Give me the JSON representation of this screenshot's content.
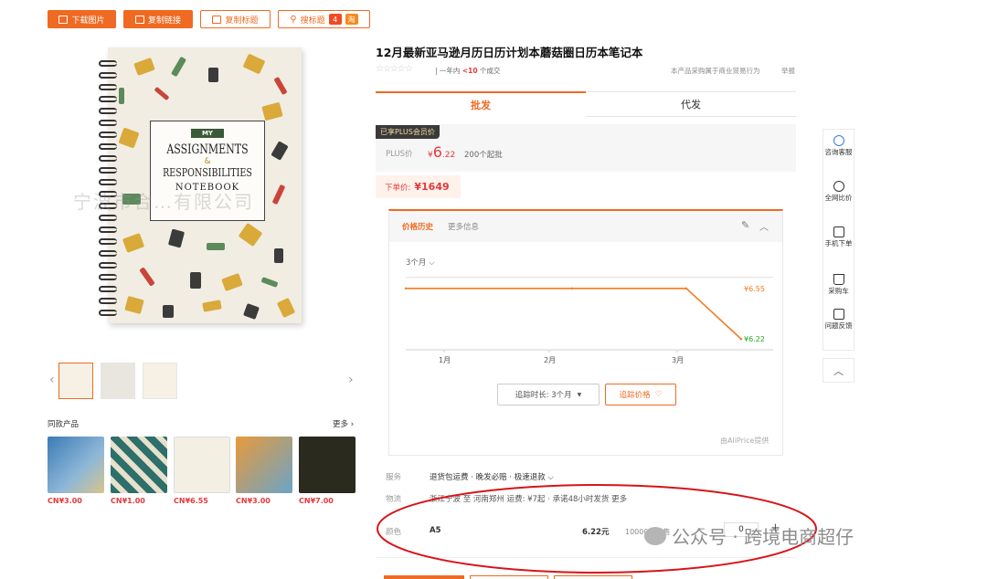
{
  "toolbar": {
    "download_image": "下载图片",
    "copy_link": "复制链接",
    "copy_title": "复制标题",
    "search_title": "搜标题",
    "badge_a": "4",
    "badge_b": "淘"
  },
  "product": {
    "title": "12月最新亚马逊月历日历计划本蘑菇圈日历本笔记本",
    "rating_note": "一年内 ",
    "deals_count": "<10",
    "deals_suffix": " 个成交",
    "purchase_note": "本产品采购属于商业贸易行为",
    "report": "举报",
    "cover_banner": "MY",
    "cover_line1": "ASSIGNMENTS",
    "cover_amp": "&",
    "cover_line2": "RESPONSIBILITIES",
    "cover_line3": "NOTEBOOK",
    "watermark": "宁波市合…有限公司"
  },
  "tabs": [
    {
      "label": "批发",
      "active": true
    },
    {
      "label": "代发",
      "active": false
    }
  ],
  "pricing": {
    "plus_tag": "已享PLUS会员价",
    "plus_label": "PLUS价",
    "plus_currency": "¥",
    "plus_int": "6",
    "plus_dec": ".22",
    "moq": "200个起批",
    "order_label": "下单价:",
    "order_price": "¥1649"
  },
  "history": {
    "tab_active": "价格历史",
    "tab_other": "更多信息",
    "range_select": "3个月",
    "track_duration": "追踪时长: 3个月",
    "track_price": "追踪价格",
    "provider": "由AliPrice提供",
    "high_label": "¥6.55",
    "low_label": "¥6.22"
  },
  "chart_data": {
    "type": "line",
    "x": [
      "1月",
      "2月",
      "3月"
    ],
    "series": [
      {
        "values": [
          6.55,
          6.55,
          6.55,
          6.22
        ]
      }
    ],
    "annotations": [
      "¥6.55",
      "¥6.22"
    ],
    "grid": false,
    "colors": {
      "line": "#f47b20",
      "high": "#f47b20",
      "low": "#1aad19"
    }
  },
  "details": {
    "service_label": "服务",
    "service_value": "退货包运费 · 晚发必赔 · 极速退款",
    "logistics_label": "物流",
    "logistics_value": "浙江宁波 至 河南郑州 运费: ¥7起 · 承诺48小时发货 更多",
    "color_label": "颜色",
    "color_value": "A5",
    "color_price": "6.22元",
    "stock": "10000个可售",
    "qty": "0"
  },
  "related": {
    "title": "同款产品",
    "more": "更多",
    "items": [
      {
        "price": "CN¥3.00"
      },
      {
        "price": "CN¥1.00"
      },
      {
        "price": "CN¥6.55"
      },
      {
        "price": "CN¥3.00"
      },
      {
        "price": "CN¥7.00"
      }
    ]
  },
  "side_rail": [
    {
      "label": "咨询客服"
    },
    {
      "label": "全网比价"
    },
    {
      "label": "手机下单"
    },
    {
      "label": "采购车"
    },
    {
      "label": "问题反馈"
    }
  ],
  "wechat_overlay": "公众号 · 跨境电商超仔",
  "colors": {
    "accent": "#ef6a22",
    "price_red": "#e4393c",
    "circle_red": "#d7141a"
  }
}
